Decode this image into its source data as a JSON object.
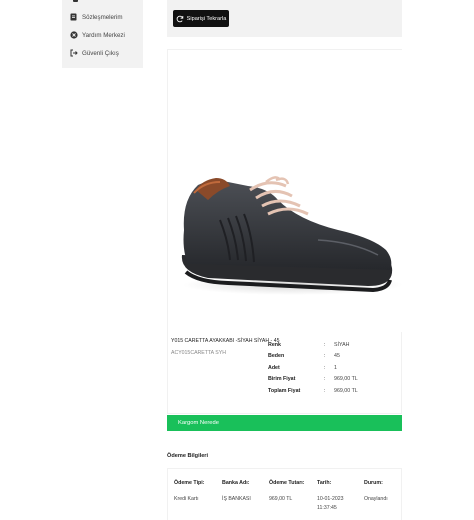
{
  "sidebar": {
    "items": [
      {
        "label": "Sözleşmelerim",
        "icon": "document-icon"
      },
      {
        "label": "Yardım Merkezi",
        "icon": "help-icon"
      },
      {
        "label": "Güvenli Çıkış",
        "icon": "logout-icon"
      }
    ]
  },
  "order": {
    "reorder_label": "Siparişi Tekrarla"
  },
  "product": {
    "name": "Y015 CARETTA AYAKKABI -SİYAH SİYAH - 45",
    "sku": "ACY015CARETTA SYH",
    "image_icon": "shoe-image",
    "details": [
      {
        "key": "Renk",
        "value": "SİYAH"
      },
      {
        "key": "Beden",
        "value": "45"
      },
      {
        "key": "Adet",
        "value": "1"
      },
      {
        "key": "Birim Fiyat",
        "value": "969,00 TL"
      },
      {
        "key": "Toplam Fiyat",
        "value": "969,00 TL"
      }
    ],
    "separator": ":"
  },
  "cargo": {
    "label": "Kargom Nerede",
    "color": "#19c05a"
  },
  "payment": {
    "title": "Ödeme Bilgileri",
    "headers": [
      "Ödeme Tipi:",
      "Banka Adı:",
      "Ödeme Tutarı:",
      "Tarih:",
      "Durum:"
    ],
    "row": {
      "type": "Kredi Kartı",
      "bank": "İŞ BANKASI",
      "amount": "969,00 TL",
      "date": "10-01-2023",
      "time": "11:37:45",
      "status": "Onaylandı"
    }
  }
}
